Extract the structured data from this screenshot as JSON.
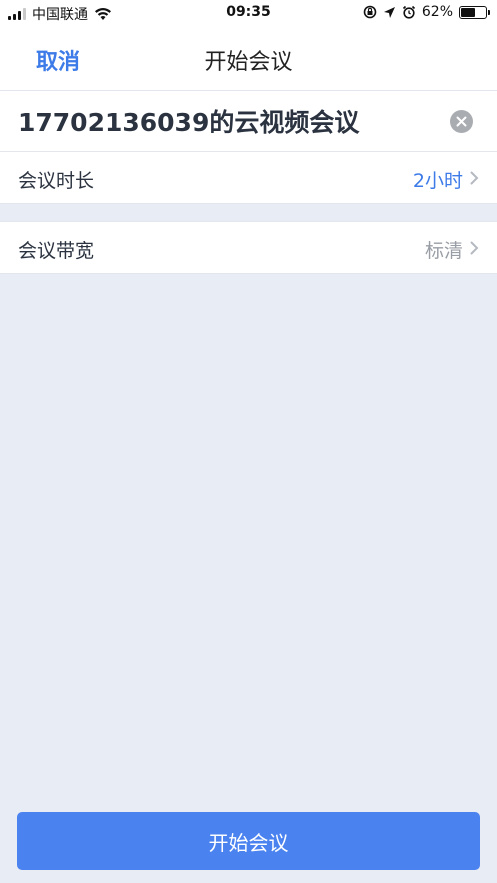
{
  "status_bar": {
    "carrier": "中国联通",
    "time": "09:35",
    "battery_percent": "62%",
    "battery_level": 0.62
  },
  "nav": {
    "cancel_label": "取消",
    "title": "开始会议"
  },
  "meeting_name": {
    "value": "17702136039的云视频会议"
  },
  "settings": {
    "duration_label": "会议时长",
    "duration_value": "2小时",
    "bandwidth_label": "会议带宽",
    "bandwidth_value": "标清"
  },
  "footer": {
    "start_label": "开始会议"
  },
  "colors": {
    "accent": "#3d7be8",
    "button": "#4a82ef",
    "background": "#e8ecf5"
  }
}
